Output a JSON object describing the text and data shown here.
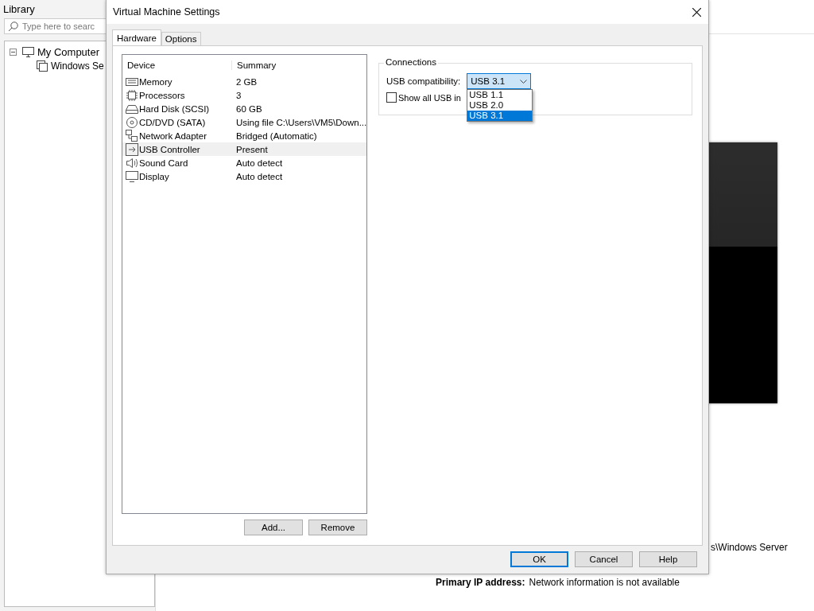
{
  "library": {
    "title": "Library",
    "search": {
      "placeholder": "Type here to searc"
    },
    "tree": [
      {
        "label": "My Computer",
        "kind": "computer",
        "expanded": true,
        "children": [
          {
            "label": "Windows Se",
            "kind": "vm",
            "selected": false
          }
        ]
      }
    ]
  },
  "details": {
    "location_tail": "s\\Windows Server",
    "ip_label": "Primary IP address:",
    "ip_value": "Network information is not available"
  },
  "dialog": {
    "title": "Virtual Machine Settings",
    "tabs": [
      {
        "label": "Hardware",
        "selected": true
      },
      {
        "label": "Options",
        "selected": false
      }
    ],
    "columns": [
      "Device",
      "Summary"
    ],
    "devices": [
      {
        "kind": "memory",
        "name": "Memory",
        "summary": "2 GB",
        "selected": false
      },
      {
        "kind": "processor",
        "name": "Processors",
        "summary": "3",
        "selected": false
      },
      {
        "kind": "disk",
        "name": "Hard Disk (SCSI)",
        "summary": "60 GB",
        "selected": false
      },
      {
        "kind": "cd",
        "name": "CD/DVD (SATA)",
        "summary": "Using file C:\\Users\\VM5\\Down...",
        "selected": false
      },
      {
        "kind": "network",
        "name": "Network Adapter",
        "summary": "Bridged (Automatic)",
        "selected": false
      },
      {
        "kind": "usb",
        "name": "USB Controller",
        "summary": "Present",
        "selected": true
      },
      {
        "kind": "sound",
        "name": "Sound Card",
        "summary": "Auto detect",
        "selected": false
      },
      {
        "kind": "display",
        "name": "Display",
        "summary": "Auto detect",
        "selected": false
      }
    ],
    "list_buttons": [
      "Add...",
      "Remove"
    ],
    "connections": {
      "title": "Connections",
      "label": "USB compatibility:",
      "value": "USB 3.1",
      "options": [
        {
          "label": "USB 1.1",
          "selected": false
        },
        {
          "label": "USB 2.0",
          "selected": false
        },
        {
          "label": "USB 3.1",
          "selected": true
        }
      ],
      "checkbox": {
        "label": "Show all USB in",
        "checked": false
      }
    },
    "buttons": [
      {
        "label": "OK",
        "default": true
      },
      {
        "label": "Cancel",
        "default": false
      },
      {
        "label": "Help",
        "default": false
      }
    ]
  }
}
